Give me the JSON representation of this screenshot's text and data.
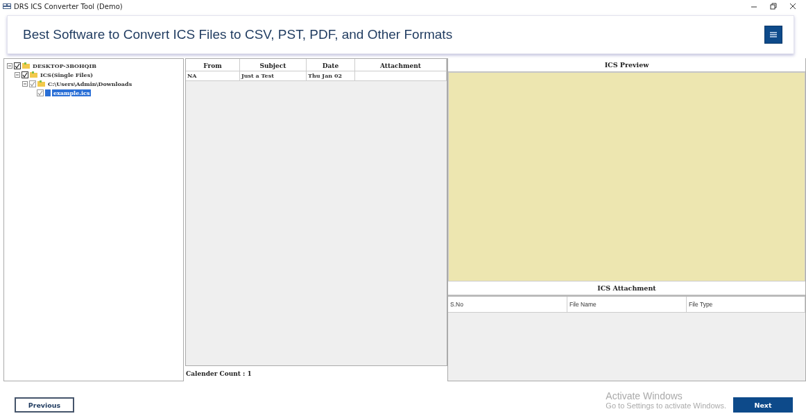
{
  "window": {
    "title": "DRS ICS Converter Tool (Demo)"
  },
  "header": {
    "title": "Best Software to Convert ICS Files to CSV, PST, PDF, and Other Formats"
  },
  "tree": [
    {
      "label": "DESKTOP-3BOHQIB",
      "checked": true,
      "expanded": true,
      "selected": false,
      "kind": "folder",
      "children": [
        {
          "label": "ICS(Single Files)",
          "checked": true,
          "expanded": true,
          "selected": false,
          "kind": "folder",
          "children": [
            {
              "label": "C:\\Users\\Admin\\Downloads",
              "checked": true,
              "expanded": true,
              "selected": false,
              "kind": "folder",
              "children": [
                {
                  "label": "example.ics",
                  "checked": true,
                  "selected": true,
                  "kind": "file"
                }
              ]
            }
          ]
        }
      ]
    }
  ],
  "messages": {
    "columns": [
      "From",
      "Subject",
      "Date",
      "Attachment"
    ],
    "rows": [
      [
        "NA",
        "Just a Test",
        "Thu Jan 02",
        ""
      ]
    ],
    "count": "Calender Count : 1"
  },
  "preview": {
    "title": "ICS Preview"
  },
  "attachments": {
    "title": "ICS Attachment",
    "columns": [
      "S.No",
      "File Name",
      "File Type"
    ]
  },
  "activation": {
    "title": "Activate Windows",
    "text": "Go to Settings to activate Windows."
  },
  "buttons": {
    "previous": "Previous",
    "next": "Next"
  }
}
